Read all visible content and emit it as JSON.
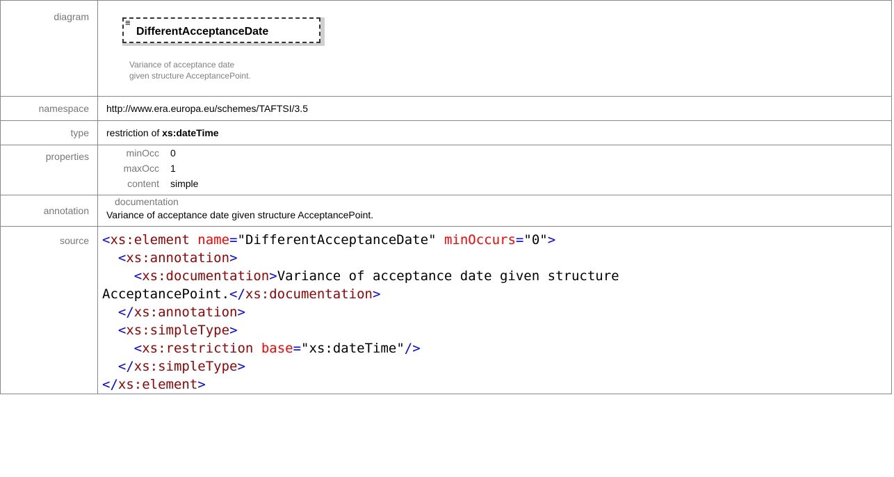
{
  "labels": {
    "diagram": "diagram",
    "namespace": "namespace",
    "type": "type",
    "properties": "properties",
    "annotation": "annotation",
    "source": "source"
  },
  "diagram": {
    "element_name": "DifferentAcceptanceDate",
    "note": "Variance of acceptance date\ngiven structure AcceptancePoint.",
    "glyph": "≡",
    "icon": "element-doc-icon"
  },
  "namespace": "http://www.era.europa.eu/schemes/TAFTSI/3.5",
  "type": {
    "prefix": "restriction of ",
    "base": "xs:dateTime"
  },
  "properties": [
    {
      "key": "minOcc",
      "value": "0"
    },
    {
      "key": "maxOcc",
      "value": "1"
    },
    {
      "key": "content",
      "value": "simple"
    }
  ],
  "annotation": {
    "title": "documentation",
    "text": "Variance of acceptance date given structure AcceptancePoint."
  },
  "source": {
    "element_tag": "xs:element",
    "annotation_tag": "xs:annotation",
    "documentation_tag": "xs:documentation",
    "simpletype_tag": "xs:simpleType",
    "restriction_tag": "xs:restriction",
    "attr_name": "name",
    "attr_name_value": "DifferentAcceptanceDate",
    "attr_minoccurs": "minOccurs",
    "attr_minoccurs_value": "0",
    "attr_base": "base",
    "attr_base_value": "xs:dateTime",
    "doc_text_line1": "Variance of acceptance date given structure",
    "doc_text_line2": "AcceptancePoint."
  }
}
